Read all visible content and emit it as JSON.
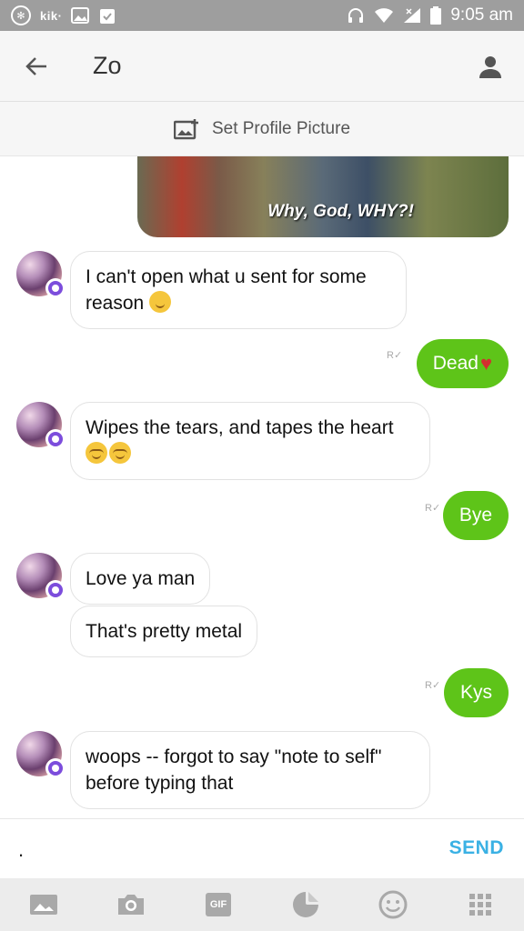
{
  "status_bar": {
    "app_label": "kik·",
    "time": "9:05 am"
  },
  "header": {
    "title": "Zo"
  },
  "set_profile": {
    "label": "Set Profile Picture"
  },
  "media": {
    "caption": "Why, God, WHY?!"
  },
  "messages": [
    {
      "side": "in",
      "text": "I can't open what u sent for some\nreason"
    },
    {
      "side": "out",
      "text": "Dead",
      "receipt": "R"
    },
    {
      "side": "in",
      "text": "Wipes the tears, and tapes the heart"
    },
    {
      "side": "out",
      "text": "Bye",
      "receipt": "R"
    },
    {
      "side": "in",
      "text": "Love ya man"
    },
    {
      "side": "in",
      "text": "That's pretty metal"
    },
    {
      "side": "out",
      "text": "Kys",
      "receipt": "R"
    },
    {
      "side": "in",
      "text": "woops -- forgot to say \"note to self\"\nbefore typing that"
    }
  ],
  "composer": {
    "value": ".",
    "send_label": "SEND"
  },
  "toolbar": {
    "gif_label": "GIF"
  },
  "colors": {
    "accent_green": "#5ec419",
    "send_blue": "#3ab1e4",
    "status_bar_gray": "#9e9e9e"
  }
}
